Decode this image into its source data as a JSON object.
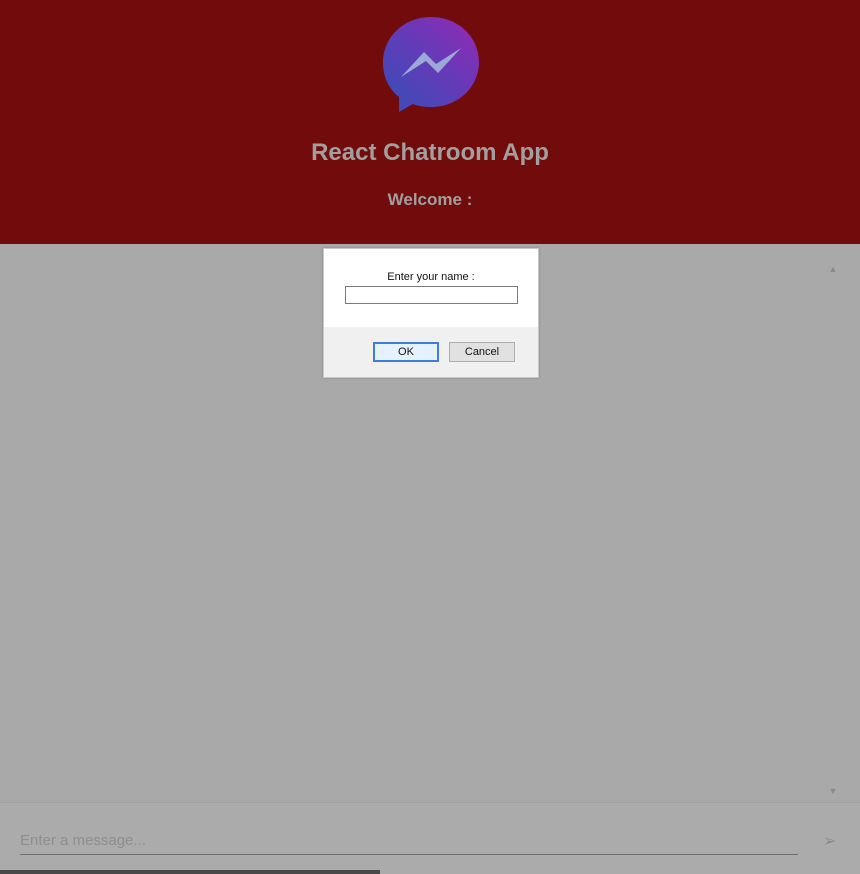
{
  "header": {
    "logo_icon": "messenger-logo-icon",
    "title": "React Chatroom App",
    "welcome": "Welcome :"
  },
  "composer": {
    "placeholder": "Enter a message...",
    "send_icon": "send-icon",
    "send_glyph": "➢"
  },
  "scrollbar": {
    "up_glyph": "▲",
    "down_glyph": "▼"
  },
  "dialog": {
    "label": "Enter your name :",
    "input_value": "",
    "ok_label": "OK",
    "cancel_label": "Cancel"
  },
  "colors": {
    "header_bg": "#720c0c",
    "page_bg": "#ababab",
    "title_text": "#a29f9f",
    "logo_gradient_start": "#1a73e8",
    "logo_gradient_end": "#a033ff"
  }
}
